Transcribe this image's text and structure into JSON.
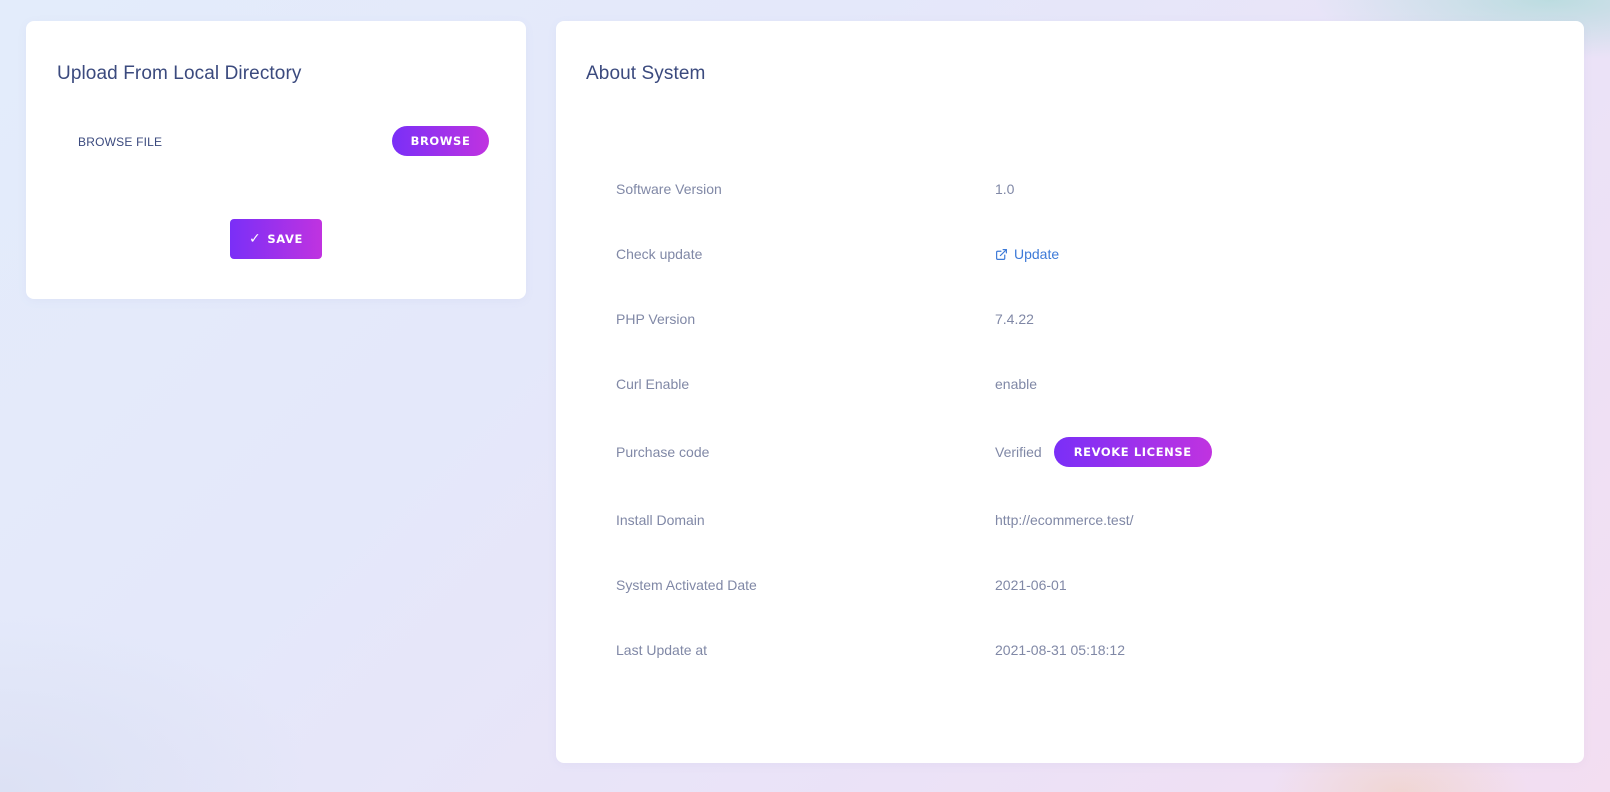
{
  "upload_card": {
    "title": "Upload From Local Directory",
    "browse_file_label": "BROWSE FILE",
    "browse_button": "BROWSE",
    "save_button": "SAVE"
  },
  "about_card": {
    "title": "About System",
    "rows": [
      {
        "label": "Software Version",
        "value": "1.0"
      },
      {
        "label": "Check update",
        "value": "Update"
      },
      {
        "label": "PHP Version",
        "value": "7.4.22"
      },
      {
        "label": "Curl Enable",
        "value": "enable"
      },
      {
        "label": "Purchase code",
        "value": "Verified",
        "action": "REVOKE LICENSE"
      },
      {
        "label": "Install Domain",
        "value": "http://ecommerce.test/"
      },
      {
        "label": "System Activated Date",
        "value": "2021-06-01"
      },
      {
        "label": "Last Update at",
        "value": "2021-08-31 05:18:12"
      }
    ]
  },
  "icons": {
    "save": "check-icon",
    "update": "external-link-icon"
  },
  "colors": {
    "accent_start": "#7a2ff7",
    "accent_end": "#c033e0",
    "title": "#3b4a7e",
    "text_muted": "#8088a6",
    "link": "#3d7ad8"
  }
}
